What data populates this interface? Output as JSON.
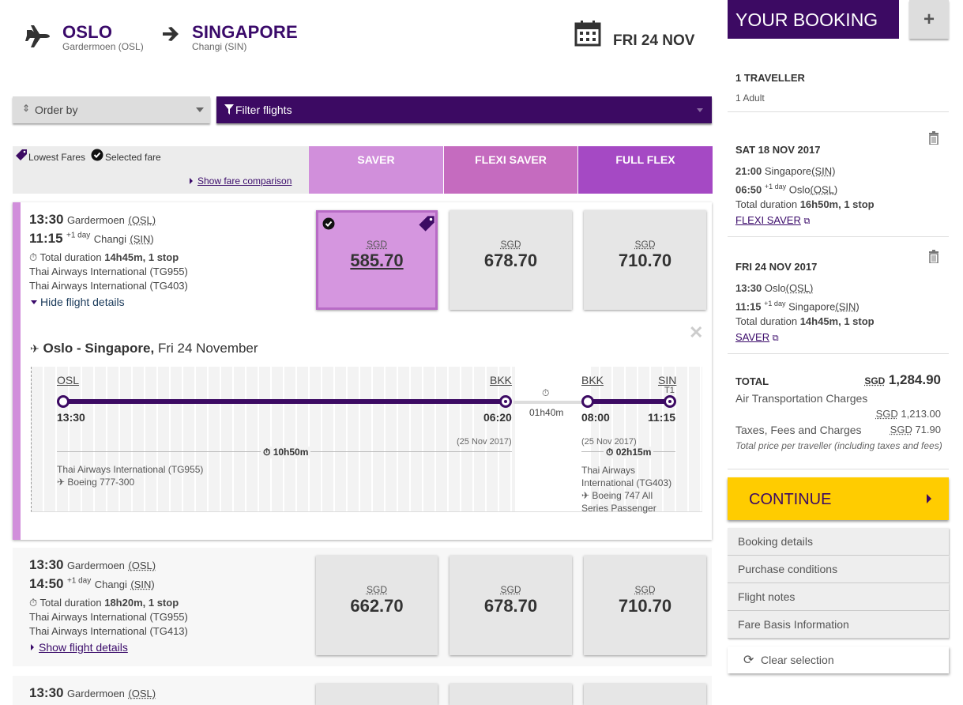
{
  "header": {
    "origin_city": "OSLO",
    "origin_airport": "Gardermoen (OSL)",
    "dest_city": "SINGAPORE",
    "dest_airport": "Changi (SIN)",
    "date": "FRI 24 NOV"
  },
  "controls": {
    "order_by": "Order by",
    "filter": "Filter flights"
  },
  "legend": {
    "lowest": "Lowest Fares",
    "selected": "Selected fare",
    "compare_link": "Show fare comparison"
  },
  "fare_types": [
    "SAVER",
    "FLEXI SAVER",
    "FULL FLEX"
  ],
  "flights": [
    {
      "dep_time": "13:30",
      "dep_airport": "Gardermoen",
      "dep_code": "(OSL)",
      "arr_time": "11:15",
      "arr_plus": "+1 day",
      "arr_airport": "Changi",
      "arr_code": "(SIN)",
      "duration_label": "Total duration",
      "duration": "14h45m, 1 stop",
      "carrier1": "Thai Airways International (TG955)",
      "carrier2": "Thai Airways International (TG403)",
      "toggle": "Hide flight details",
      "prices": [
        {
          "cur": "SGD",
          "amt": "585.70"
        },
        {
          "cur": "SGD",
          "amt": "678.70"
        },
        {
          "cur": "SGD",
          "amt": "710.70"
        }
      ]
    },
    {
      "dep_time": "13:30",
      "dep_airport": "Gardermoen",
      "dep_code": "(OSL)",
      "arr_time": "14:50",
      "arr_plus": "+1 day",
      "arr_airport": "Changi",
      "arr_code": "(SIN)",
      "duration_label": "Total duration",
      "duration": "18h20m, 1 stop",
      "carrier1": "Thai Airways International (TG955)",
      "carrier2": "Thai Airways International (TG413)",
      "toggle": "Show flight details",
      "prices": [
        {
          "cur": "SGD",
          "amt": "662.70"
        },
        {
          "cur": "SGD",
          "amt": "678.70"
        },
        {
          "cur": "SGD",
          "amt": "710.70"
        }
      ]
    },
    {
      "dep_time": "13:30",
      "dep_airport": "Gardermoen",
      "dep_code": "(OSL)"
    }
  ],
  "details": {
    "title_route": "Oslo - Singapore,",
    "title_date": "Fri 24 November",
    "seg1": {
      "from": "OSL",
      "to": "BKK",
      "dep": "13:30",
      "arr": "06:20",
      "arr_date": "(25 Nov 2017)",
      "duration": "10h50m",
      "carrier": "Thai Airways International (TG955)",
      "aircraft": "Boeing 777-300"
    },
    "layover": "01h40m",
    "seg2": {
      "from": "BKK",
      "to": "SIN",
      "terminal": "T1",
      "dep": "08:00",
      "arr": "11:15",
      "dep_date": "(25 Nov 2017)",
      "duration": "02h15m",
      "carrier_line1": "Thai Airways",
      "carrier_line2": "International (TG403)",
      "aircraft_line1": "Boeing 747 All",
      "aircraft_line2": "Series Passenger"
    }
  },
  "sidebar": {
    "title": "YOUR BOOKING",
    "plus": "+",
    "travellers": "1 TRAVELLER",
    "adults": "1 Adult",
    "leg1": {
      "date": "SAT 18 NOV 2017",
      "dep_time": "21:00",
      "dep_place": "Singapore",
      "dep_code": "(SIN)",
      "arr_time": "06:50",
      "arr_plus": "+1 day",
      "arr_place": "Oslo",
      "arr_code": "(OSL)",
      "dur_label": "Total duration",
      "duration": "16h50m, 1 stop",
      "fare": "FLEXI SAVER"
    },
    "leg2": {
      "date": "FRI 24 NOV 2017",
      "dep_time": "13:30",
      "dep_place": "Oslo",
      "dep_code": "(OSL)",
      "arr_time": "11:15",
      "arr_plus": "+1 day",
      "arr_place": "Singapore",
      "arr_code": "(SIN)",
      "dur_label": "Total duration",
      "duration": "14h45m, 1 stop",
      "fare": "SAVER"
    },
    "total_label": "TOTAL",
    "total_cur": "SGD",
    "total_amt": "1,284.90",
    "air_label": "Air Transportation Charges",
    "air_cur": "SGD",
    "air_amt": "1,213.00",
    "tax_label": "Taxes, Fees and Charges",
    "tax_cur": "SGD",
    "tax_amt": "71.90",
    "note": "Total price per traveller (including taxes and fees)",
    "continue": "CONTINUE",
    "links": [
      "Booking details",
      "Purchase conditions",
      "Flight notes",
      "Fare Basis Information"
    ],
    "clear": "Clear selection"
  },
  "colors": {
    "purple": "#3c0a63",
    "saver": "#d18fdb",
    "flexi": "#c56bbf",
    "full": "#a549c4",
    "continue": "#ffcc00"
  }
}
